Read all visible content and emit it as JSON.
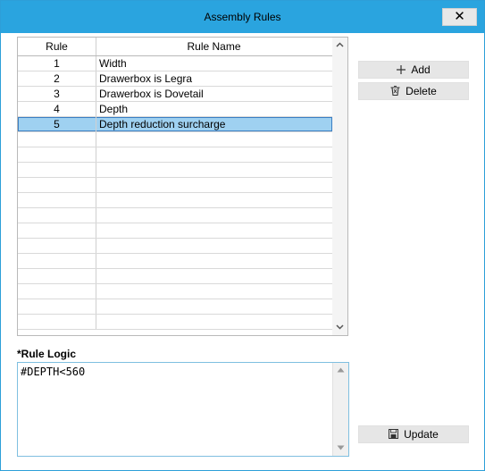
{
  "window": {
    "title": "Assembly Rules",
    "close_icon": "close-icon",
    "accent": "#2aa4df"
  },
  "grid": {
    "columns": [
      "Rule",
      "Rule Name"
    ],
    "rows": [
      {
        "rule": "1",
        "name": "Width"
      },
      {
        "rule": "2",
        "name": "Drawerbox is Legra"
      },
      {
        "rule": "3",
        "name": "Drawerbox is Dovetail"
      },
      {
        "rule": "4",
        "name": "Depth"
      },
      {
        "rule": "5",
        "name": "Depth reduction surcharge"
      }
    ],
    "selected_rule": "5",
    "selected_color": "#9fd1f1",
    "scroll_up_icon": "chevron-up-icon",
    "scroll_down_icon": "chevron-down-icon"
  },
  "actions": {
    "add_label": "Add",
    "add_icon": "plus-icon",
    "delete_label": "Delete",
    "delete_icon": "trash-icon",
    "update_label": "Update",
    "update_icon": "save-icon"
  },
  "logic": {
    "label": "*Rule Logic",
    "value": "#DEPTH<560"
  }
}
